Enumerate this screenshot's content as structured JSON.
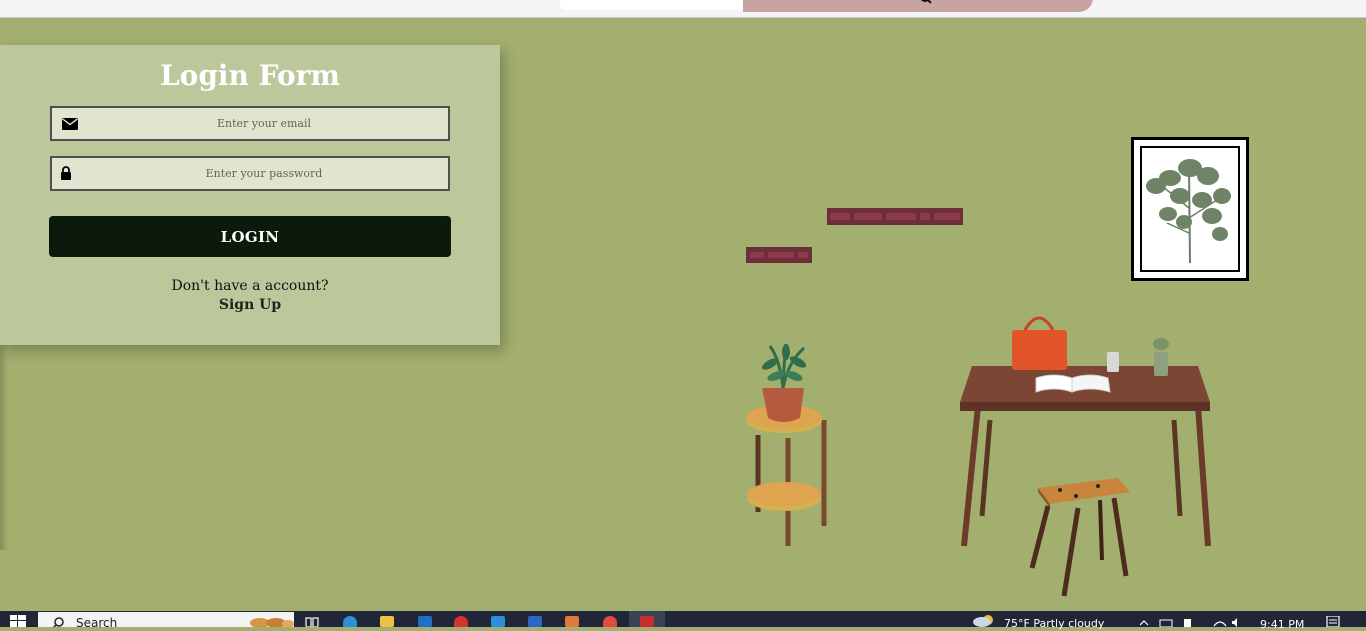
{
  "login": {
    "title": "Login Form",
    "email_placeholder": "Enter your email",
    "password_placeholder": "Enter your password",
    "login_button": "LOGIN",
    "no_account_text": "Don't have a account?",
    "signup_link": "Sign Up"
  },
  "taskbar": {
    "search_label": "Search",
    "weather": "75°F  Partly cloudy",
    "time": "9:41 PM"
  },
  "icons": {
    "email": "envelope-icon",
    "password": "lock-icon",
    "browser_search": "search-icon"
  },
  "colors": {
    "background": "#a2af6e",
    "panel": "#bcc89b",
    "field": "#e0e5cf",
    "button": "#0b1a0a",
    "shelf": "#6e2d3a"
  }
}
